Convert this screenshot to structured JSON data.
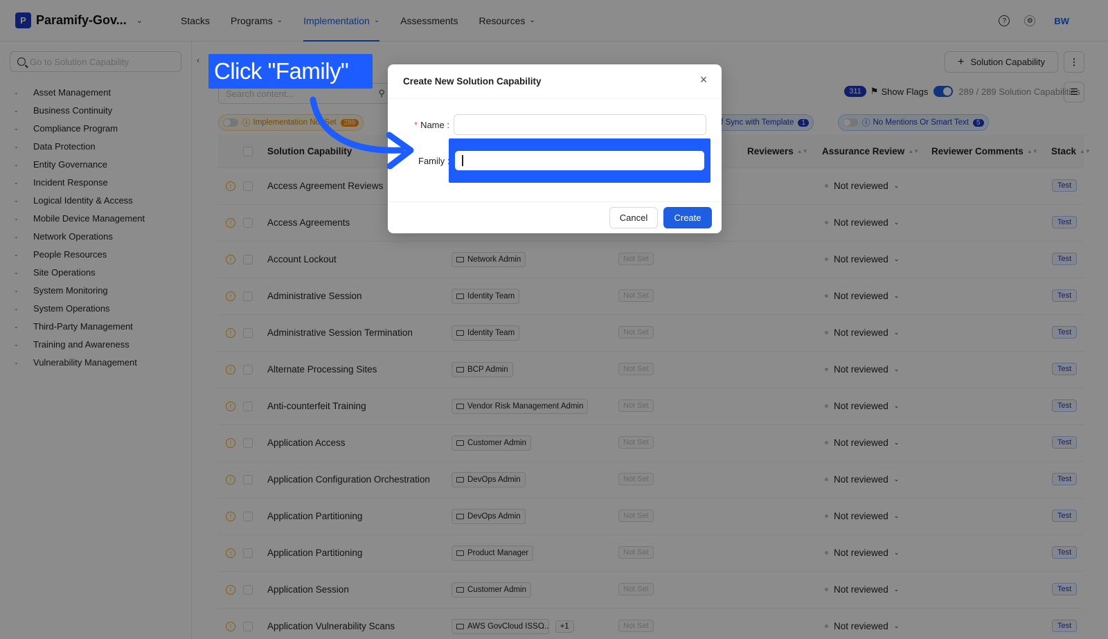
{
  "app": {
    "brand_name": "Paramify-Gov...",
    "brand_logo_letter": "P"
  },
  "nav": {
    "items": [
      {
        "label": "Stacks",
        "has_chevron": false,
        "active": false
      },
      {
        "label": "Programs",
        "has_chevron": true,
        "active": false
      },
      {
        "label": "Implementation",
        "has_chevron": true,
        "active": true
      },
      {
        "label": "Assessments",
        "has_chevron": false,
        "active": false
      },
      {
        "label": "Resources",
        "has_chevron": true,
        "active": false
      }
    ],
    "help_icon": "help-circle-icon",
    "settings_icon": "gear-icon",
    "avatar_initials": "BW"
  },
  "sidebar": {
    "search_placeholder": "Go to Solution Capability",
    "items": [
      "Asset Management",
      "Business Continuity",
      "Compliance Program",
      "Data Protection",
      "Entity Governance",
      "Incident Response",
      "Logical Identity & Access",
      "Mobile Device Management",
      "Network Operations",
      "People Resources",
      "Site Operations",
      "System Monitoring",
      "System Operations",
      "Third-Party Management",
      "Training and Awareness",
      "Vulnerability Management"
    ]
  },
  "main": {
    "add_button_label": "Solution Capability",
    "content_search_placeholder": "Search content...",
    "flags_count": "311",
    "show_flags_label": "Show Flags",
    "capability_count": "289 / 289 Solution Capabilities",
    "chips": {
      "implementation": {
        "label": "Implementation Not Set",
        "count": "289"
      },
      "sync": {
        "label": "ut of Sync with Template",
        "count": "1"
      },
      "mentions": {
        "label": "No Mentions Or Smart Text",
        "count": "5"
      }
    },
    "columns": {
      "name": "Solution Capability",
      "reviewers": "Reviewers",
      "assurance_review": "Assurance Review",
      "reviewer_comments": "Reviewer Comments",
      "stack": "Stack"
    },
    "rows": [
      {
        "name": "Access Agreement Reviews",
        "owner": "",
        "notset": "",
        "review": "Not reviewed",
        "stack": "Test"
      },
      {
        "name": "Access Agreements",
        "owner": "",
        "notset": "",
        "review": "Not reviewed",
        "stack": "Test"
      },
      {
        "name": "Account Lockout",
        "owner": "Network Admin",
        "notset": "Not Set",
        "review": "Not reviewed",
        "stack": "Test"
      },
      {
        "name": "Administrative Session",
        "owner": "Identity Team",
        "notset": "Not Set",
        "review": "Not reviewed",
        "stack": "Test"
      },
      {
        "name": "Administrative Session Termination",
        "owner": "Identity Team",
        "notset": "Not Set",
        "review": "Not reviewed",
        "stack": "Test"
      },
      {
        "name": "Alternate Processing Sites",
        "owner": "BCP Admin",
        "notset": "Not Set",
        "review": "Not reviewed",
        "stack": "Test"
      },
      {
        "name": "Anti-counterfeit Training",
        "owner": "Vendor Risk Management Admin",
        "notset": "Not Set",
        "review": "Not reviewed",
        "stack": "Test"
      },
      {
        "name": "Application Access",
        "owner": "Customer Admin",
        "notset": "Not Set",
        "review": "Not reviewed",
        "stack": "Test"
      },
      {
        "name": "Application Configuration Orchestration",
        "owner": "DevOps Admin",
        "notset": "Not Set",
        "review": "Not reviewed",
        "stack": "Test"
      },
      {
        "name": "Application Partitioning",
        "owner": "DevOps Admin",
        "notset": "Not Set",
        "review": "Not reviewed",
        "stack": "Test"
      },
      {
        "name": "Application Partitioning",
        "owner": "Product Manager",
        "notset": "Not Set",
        "review": "Not reviewed",
        "stack": "Test"
      },
      {
        "name": "Application Session",
        "owner": "Customer Admin",
        "notset": "Not Set",
        "review": "Not reviewed",
        "stack": "Test"
      },
      {
        "name": "Application Vulnerability Scans",
        "owner": "AWS GovCloud ISSO",
        "extra": "+1",
        "notset": "Not Set",
        "review": "Not reviewed",
        "stack": "Test"
      }
    ]
  },
  "modal": {
    "title": "Create New Solution Capability",
    "name_label": "Name",
    "family_label": "Family",
    "name_value": "",
    "family_value": "",
    "cancel_label": "Cancel",
    "create_label": "Create"
  },
  "callout": {
    "text": "Click \"Family\"",
    "color": "#1d5cff"
  }
}
